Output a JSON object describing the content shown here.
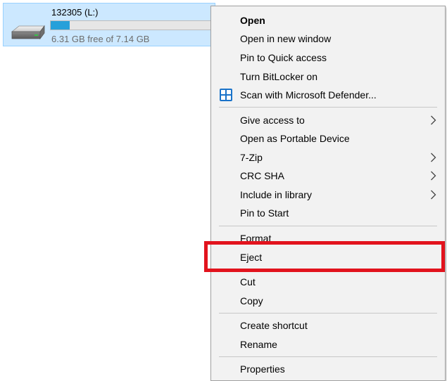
{
  "drive": {
    "name": "132305 (L:)",
    "free_text": "6.31 GB free of 7.14 GB",
    "used_fraction": 0.116,
    "icon": "drive-icon"
  },
  "context_menu": {
    "open": "Open",
    "open_new_window": "Open in new window",
    "pin_quick_access": "Pin to Quick access",
    "turn_bitlocker_on": "Turn BitLocker on",
    "scan_defender": "Scan with Microsoft Defender...",
    "give_access": "Give access to",
    "open_portable": "Open as Portable Device",
    "seven_zip": "7-Zip",
    "crc_sha": "CRC SHA",
    "include_library": "Include in library",
    "pin_start": "Pin to Start",
    "format": "Format",
    "eject": "Eject",
    "cut": "Cut",
    "copy": "Copy",
    "create_shortcut": "Create shortcut",
    "rename": "Rename",
    "properties": "Properties"
  },
  "colors": {
    "selection": "#cce8ff",
    "usage_fill": "#26a0da",
    "highlight": "#e2131d"
  }
}
